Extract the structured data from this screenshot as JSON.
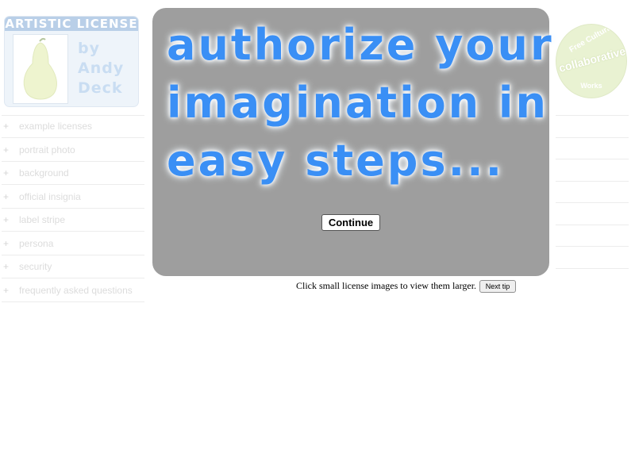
{
  "logo": {
    "title": "ARTISTIC LICENSE",
    "byline_lines": [
      "by",
      "Andy",
      "Deck"
    ],
    "photo_alt": "pear-image"
  },
  "nav": {
    "items": [
      {
        "label": "example licenses"
      },
      {
        "label": "portrait photo"
      },
      {
        "label": "background"
      },
      {
        "label": "official insignia"
      },
      {
        "label": "label stripe"
      },
      {
        "label": "persona"
      },
      {
        "label": "security"
      },
      {
        "label": "frequently asked questions"
      }
    ],
    "bullet": "+"
  },
  "badge": {
    "top": "Free Cultural",
    "middle": "collaborative",
    "bottom": "Works"
  },
  "modal": {
    "headline_lines": [
      "authorize your",
      "imagination in",
      "easy steps..."
    ],
    "continue_label": "Continue"
  },
  "tips": {
    "text": "Click small license images to view them larger.",
    "next_label": "Next tip"
  },
  "colors": {
    "modal_bg": "#9e9e9e",
    "headline": "#3a8ff5",
    "faded_text": "#dcdcdc"
  }
}
